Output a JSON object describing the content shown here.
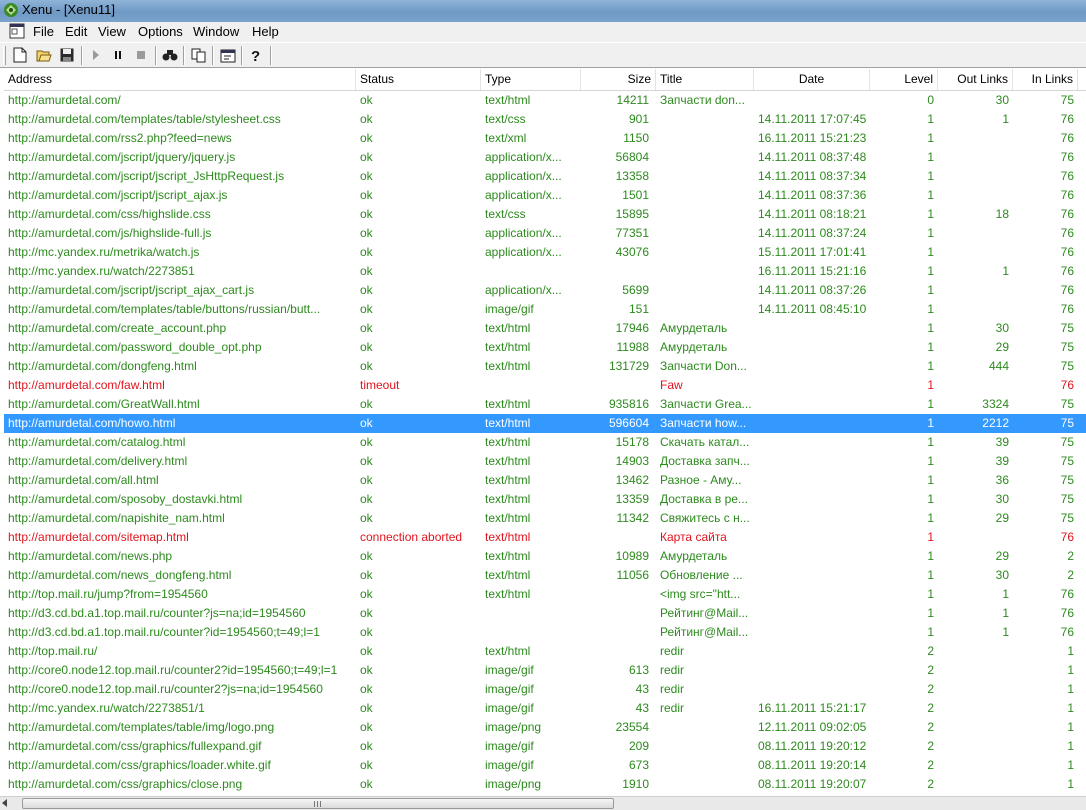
{
  "window": {
    "title": "Xenu - [Xenu11]"
  },
  "menu": [
    "File",
    "Edit",
    "View",
    "Options",
    "Window",
    "Help"
  ],
  "toolbar": {
    "buttons": [
      "new-icon",
      "open-icon",
      "save-icon",
      "play-icon",
      "pause-icon",
      "stop-icon",
      "find-icon",
      "copy-icon",
      "properties-icon",
      "help-icon"
    ]
  },
  "columns": [
    "Address",
    "Status",
    "Type",
    "Size",
    "Title",
    "Date",
    "Level",
    "Out Links",
    "In Links"
  ],
  "colors": {
    "ok": "#2d8a1e",
    "error": "#e0141e",
    "selected_bg": "#3399ff",
    "selected_fg": "#ffffff"
  },
  "rows": [
    {
      "url": "http://amurdetal.com/",
      "status": "ok",
      "type": "text/html",
      "size": "14211",
      "title": "Запчасти don...",
      "date": "",
      "level": "0",
      "out": "30",
      "in": "75",
      "state": "ok"
    },
    {
      "url": "http://amurdetal.com/templates/table/stylesheet.css",
      "status": "ok",
      "type": "text/css",
      "size": "901",
      "title": "",
      "date": "14.11.2011  17:07:45",
      "level": "1",
      "out": "1",
      "in": "76",
      "state": "ok"
    },
    {
      "url": "http://amurdetal.com/rss2.php?feed=news",
      "status": "ok",
      "type": "text/xml",
      "size": "1150",
      "title": "",
      "date": "16.11.2011  15:21:23",
      "level": "1",
      "out": "",
      "in": "76",
      "state": "ok"
    },
    {
      "url": "http://amurdetal.com/jscript/jquery/jquery.js",
      "status": "ok",
      "type": "application/x...",
      "size": "56804",
      "title": "",
      "date": "14.11.2011  08:37:48",
      "level": "1",
      "out": "",
      "in": "76",
      "state": "ok"
    },
    {
      "url": "http://amurdetal.com/jscript/jscript_JsHttpRequest.js",
      "status": "ok",
      "type": "application/x...",
      "size": "13358",
      "title": "",
      "date": "14.11.2011  08:37:34",
      "level": "1",
      "out": "",
      "in": "76",
      "state": "ok"
    },
    {
      "url": "http://amurdetal.com/jscript/jscript_ajax.js",
      "status": "ok",
      "type": "application/x...",
      "size": "1501",
      "title": "",
      "date": "14.11.2011  08:37:36",
      "level": "1",
      "out": "",
      "in": "76",
      "state": "ok"
    },
    {
      "url": "http://amurdetal.com/css/highslide.css",
      "status": "ok",
      "type": "text/css",
      "size": "15895",
      "title": "",
      "date": "14.11.2011  08:18:21",
      "level": "1",
      "out": "18",
      "in": "76",
      "state": "ok"
    },
    {
      "url": "http://amurdetal.com/js/highslide-full.js",
      "status": "ok",
      "type": "application/x...",
      "size": "77351",
      "title": "",
      "date": "14.11.2011  08:37:24",
      "level": "1",
      "out": "",
      "in": "76",
      "state": "ok"
    },
    {
      "url": "http://mc.yandex.ru/metrika/watch.js",
      "status": "ok",
      "type": "application/x...",
      "size": "43076",
      "title": "",
      "date": "15.11.2011  17:01:41",
      "level": "1",
      "out": "",
      "in": "76",
      "state": "ok"
    },
    {
      "url": "http://mc.yandex.ru/watch/2273851",
      "status": "ok",
      "type": "",
      "size": "",
      "title": "",
      "date": "16.11.2011  15:21:16",
      "level": "1",
      "out": "1",
      "in": "76",
      "state": "ok"
    },
    {
      "url": "http://amurdetal.com/jscript/jscript_ajax_cart.js",
      "status": "ok",
      "type": "application/x...",
      "size": "5699",
      "title": "",
      "date": "14.11.2011  08:37:26",
      "level": "1",
      "out": "",
      "in": "76",
      "state": "ok"
    },
    {
      "url": "http://amurdetal.com/templates/table/buttons/russian/butt...",
      "status": "ok",
      "type": "image/gif",
      "size": "151",
      "title": "",
      "date": "14.11.2011  08:45:10",
      "level": "1",
      "out": "",
      "in": "76",
      "state": "ok"
    },
    {
      "url": "http://amurdetal.com/create_account.php",
      "status": "ok",
      "type": "text/html",
      "size": "17946",
      "title": "Амурдеталь",
      "date": "",
      "level": "1",
      "out": "30",
      "in": "75",
      "state": "ok"
    },
    {
      "url": "http://amurdetal.com/password_double_opt.php",
      "status": "ok",
      "type": "text/html",
      "size": "11988",
      "title": "Амурдеталь",
      "date": "",
      "level": "1",
      "out": "29",
      "in": "75",
      "state": "ok"
    },
    {
      "url": "http://amurdetal.com/dongfeng.html",
      "status": "ok",
      "type": "text/html",
      "size": "131729",
      "title": "Запчасти Don...",
      "date": "",
      "level": "1",
      "out": "444",
      "in": "75",
      "state": "ok"
    },
    {
      "url": "http://amurdetal.com/faw.html",
      "status": "timeout",
      "type": "",
      "size": "",
      "title": "Faw",
      "date": "",
      "level": "1",
      "out": "",
      "in": "76",
      "state": "error"
    },
    {
      "url": "http://amurdetal.com/GreatWall.html",
      "status": "ok",
      "type": "text/html",
      "size": "935816",
      "title": "Запчасти Grea...",
      "date": "",
      "level": "1",
      "out": "3324",
      "in": "75",
      "state": "ok"
    },
    {
      "url": "http://amurdetal.com/howo.html",
      "status": "ok",
      "type": "text/html",
      "size": "596604",
      "title": "Запчасти how...",
      "date": "",
      "level": "1",
      "out": "2212",
      "in": "75",
      "state": "selected"
    },
    {
      "url": "http://amurdetal.com/catalog.html",
      "status": "ok",
      "type": "text/html",
      "size": "15178",
      "title": "Скачать катал...",
      "date": "",
      "level": "1",
      "out": "39",
      "in": "75",
      "state": "ok"
    },
    {
      "url": "http://amurdetal.com/delivery.html",
      "status": "ok",
      "type": "text/html",
      "size": "14903",
      "title": "Доставка запч...",
      "date": "",
      "level": "1",
      "out": "39",
      "in": "75",
      "state": "ok"
    },
    {
      "url": "http://amurdetal.com/all.html",
      "status": "ok",
      "type": "text/html",
      "size": "13462",
      "title": "Разное - Аму...",
      "date": "",
      "level": "1",
      "out": "36",
      "in": "75",
      "state": "ok"
    },
    {
      "url": "http://amurdetal.com/sposoby_dostavki.html",
      "status": "ok",
      "type": "text/html",
      "size": "13359",
      "title": "Доставка в ре...",
      "date": "",
      "level": "1",
      "out": "30",
      "in": "75",
      "state": "ok"
    },
    {
      "url": "http://amurdetal.com/napishite_nam.html",
      "status": "ok",
      "type": "text/html",
      "size": "11342",
      "title": "Свяжитесь с н...",
      "date": "",
      "level": "1",
      "out": "29",
      "in": "75",
      "state": "ok"
    },
    {
      "url": "http://amurdetal.com/sitemap.html",
      "status": "connection aborted",
      "type": "text/html",
      "size": "",
      "title": "Карта сайта",
      "date": "",
      "level": "1",
      "out": "",
      "in": "76",
      "state": "error"
    },
    {
      "url": "http://amurdetal.com/news.php",
      "status": "ok",
      "type": "text/html",
      "size": "10989",
      "title": "Амурдеталь",
      "date": "",
      "level": "1",
      "out": "29",
      "in": "2",
      "state": "ok"
    },
    {
      "url": "http://amurdetal.com/news_dongfeng.html",
      "status": "ok",
      "type": "text/html",
      "size": "11056",
      "title": "Обновление ...",
      "date": "",
      "level": "1",
      "out": "30",
      "in": "2",
      "state": "ok"
    },
    {
      "url": "http://top.mail.ru/jump?from=1954560",
      "status": "ok",
      "type": "text/html",
      "size": "",
      "title": "<img src=\"htt...",
      "date": "",
      "level": "1",
      "out": "1",
      "in": "76",
      "state": "ok"
    },
    {
      "url": "http://d3.cd.bd.a1.top.mail.ru/counter?js=na;id=1954560",
      "status": "ok",
      "type": "",
      "size": "",
      "title": "Рейтинг@Mail...",
      "date": "",
      "level": "1",
      "out": "1",
      "in": "76",
      "state": "ok"
    },
    {
      "url": "http://d3.cd.bd.a1.top.mail.ru/counter?id=1954560;t=49;l=1",
      "status": "ok",
      "type": "",
      "size": "",
      "title": "Рейтинг@Mail...",
      "date": "",
      "level": "1",
      "out": "1",
      "in": "76",
      "state": "ok"
    },
    {
      "url": "http://top.mail.ru/",
      "status": "ok",
      "type": "text/html",
      "size": "",
      "title": "redir",
      "date": "",
      "level": "2",
      "out": "",
      "in": "1",
      "state": "ok"
    },
    {
      "url": "http://core0.node12.top.mail.ru/counter2?id=1954560;t=49;l=1",
      "status": "ok",
      "type": "image/gif",
      "size": "613",
      "title": "redir",
      "date": "",
      "level": "2",
      "out": "",
      "in": "1",
      "state": "ok"
    },
    {
      "url": "http://core0.node12.top.mail.ru/counter2?js=na;id=1954560",
      "status": "ok",
      "type": "image/gif",
      "size": "43",
      "title": "redir",
      "date": "",
      "level": "2",
      "out": "",
      "in": "1",
      "state": "ok"
    },
    {
      "url": "http://mc.yandex.ru/watch/2273851/1",
      "status": "ok",
      "type": "image/gif",
      "size": "43",
      "title": "redir",
      "date": "16.11.2011  15:21:17",
      "level": "2",
      "out": "",
      "in": "1",
      "state": "ok"
    },
    {
      "url": "http://amurdetal.com/templates/table/img/logo.png",
      "status": "ok",
      "type": "image/png",
      "size": "23554",
      "title": "",
      "date": "12.11.2011  09:02:05",
      "level": "2",
      "out": "",
      "in": "1",
      "state": "ok"
    },
    {
      "url": "http://amurdetal.com/css/graphics/fullexpand.gif",
      "status": "ok",
      "type": "image/gif",
      "size": "209",
      "title": "",
      "date": "08.11.2011  19:20:12",
      "level": "2",
      "out": "",
      "in": "1",
      "state": "ok"
    },
    {
      "url": "http://amurdetal.com/css/graphics/loader.white.gif",
      "status": "ok",
      "type": "image/gif",
      "size": "673",
      "title": "",
      "date": "08.11.2011  19:20:14",
      "level": "2",
      "out": "",
      "in": "1",
      "state": "ok"
    },
    {
      "url": "http://amurdetal.com/css/graphics/close.png",
      "status": "ok",
      "type": "image/png",
      "size": "1910",
      "title": "",
      "date": "08.11.2011  19:20:07",
      "level": "2",
      "out": "",
      "in": "1",
      "state": "ok"
    }
  ]
}
